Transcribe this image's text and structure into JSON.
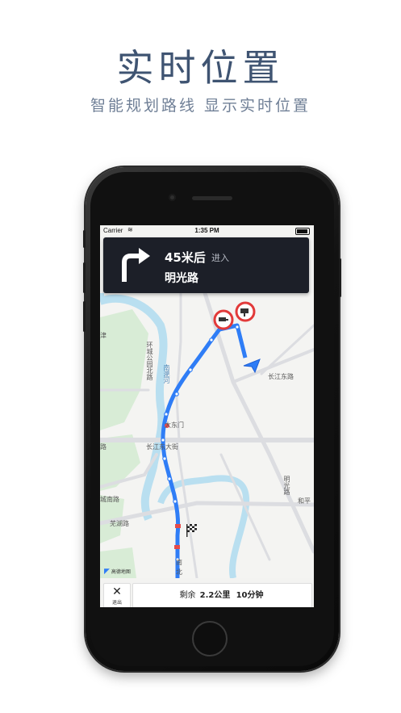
{
  "headline": "实时位置",
  "subheadline": "智能规划路线 显示实时位置",
  "status_bar": {
    "carrier": "Carrier",
    "time": "1:35 PM"
  },
  "navigation": {
    "distance": "45米后",
    "action": "进入",
    "road": "明光路",
    "turn_icon": "turn-right-arrow"
  },
  "map_labels": {
    "huancheng": "环城公园北路",
    "nanfei": "南淝河",
    "changjiang_east_road": "长江东路",
    "dadongmen": "大东门",
    "changjiang_east_street": "长江东大街",
    "wuhu_road": "芜湖路",
    "chengnan_road": "城南路",
    "mingguang_road": "明光路",
    "heping": "和平",
    "jin": "津",
    "road_a": "路",
    "north": "北",
    "south": "南",
    "dong": "东"
  },
  "map_logo": "高德地图",
  "bottom": {
    "exit_label": "退出",
    "remain_label": "剩余",
    "remain_distance": "2.2公里",
    "remain_time": "10分钟"
  },
  "colors": {
    "route": "#2f7df6",
    "nav_card": "#1c1f28",
    "headline": "#3f5472"
  }
}
